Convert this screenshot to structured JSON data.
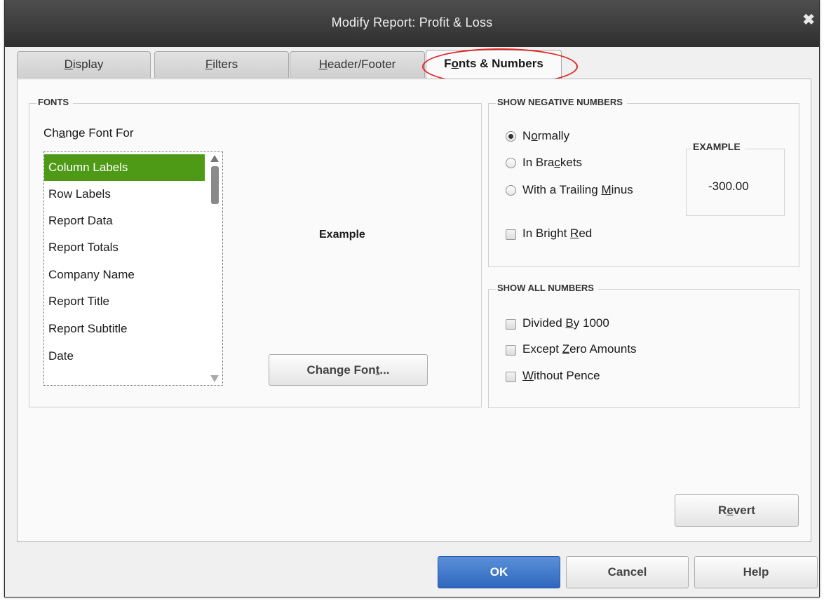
{
  "dialog": {
    "title": "Modify Report: Profit & Loss",
    "close_icon": "close-icon"
  },
  "tabs": [
    {
      "label_pre": "",
      "label_ul": "D",
      "label_post": "isplay"
    },
    {
      "label_pre": "",
      "label_ul": "F",
      "label_post": "ilters"
    },
    {
      "label_pre": "",
      "label_ul": "H",
      "label_post": "eader/Footer"
    },
    {
      "label_pre": "F",
      "label_ul": "o",
      "label_post": "nts & Numbers",
      "active": true
    }
  ],
  "fonts": {
    "group_title": "FONTS",
    "change_font_for_pre": "Ch",
    "change_font_for_ul": "a",
    "change_font_for_post": "nge Font For",
    "items": [
      "Column Labels",
      "Row Labels",
      "Report Data",
      "Report Totals",
      "Company Name",
      "Report Title",
      "Report Subtitle",
      "Date"
    ],
    "selected_item": "Column Labels",
    "example_label": "Example",
    "change_font_button": {
      "pre": "Change Fon",
      "ul": "t",
      "post": "..."
    }
  },
  "negative_numbers": {
    "group_title": "SHOW NEGATIVE NUMBERS",
    "options": [
      {
        "pre": "N",
        "ul": "o",
        "post": "rmally",
        "checked": true
      },
      {
        "pre": "In Bra",
        "ul": "c",
        "post": "kets",
        "checked": false
      },
      {
        "pre": "With a Trailing ",
        "ul": "M",
        "post": "inus",
        "checked": false
      }
    ],
    "bright_red": {
      "pre": "In Bright ",
      "ul": "R",
      "post": "ed",
      "checked": false
    },
    "example_title": "EXAMPLE",
    "example_value": "-300.00"
  },
  "all_numbers": {
    "group_title": "SHOW ALL NUMBERS",
    "options": [
      {
        "pre": "Divided ",
        "ul": "B",
        "post": "y 1000",
        "checked": false
      },
      {
        "pre": "Except ",
        "ul": "Z",
        "post": "ero Amounts",
        "checked": false
      },
      {
        "pre": "",
        "ul": "W",
        "post": "ithout Pence",
        "checked": false
      }
    ]
  },
  "buttons": {
    "revert": {
      "pre": "R",
      "ul": "e",
      "post": "vert"
    },
    "ok": "OK",
    "cancel": "Cancel",
    "help": "Help"
  },
  "colors": {
    "title_bar": "#3a3a3a",
    "selected_item": "#4e9a16",
    "ok_button": "#3a74c8",
    "highlight_ellipse": "#e02424"
  }
}
